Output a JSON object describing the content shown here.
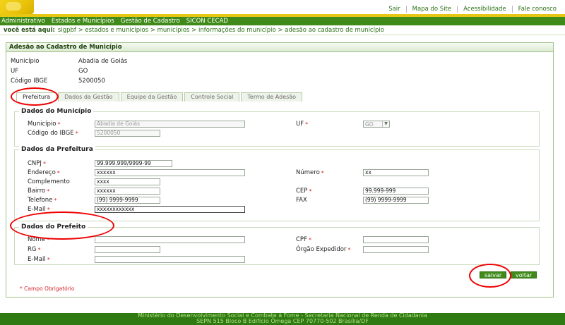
{
  "top_links": [
    "Sair",
    "Mapa do Site",
    "Acessibilidade",
    "Fale conosco"
  ],
  "main_nav": [
    "Administrativo",
    "Estados e Municípios",
    "Gestão de Cadastro",
    "SICON CECAD"
  ],
  "breadcrumb": {
    "here": "você está aqui:",
    "path": "sigpbf > estados e municípios > municípios > informações do município > adesão ao cadastro de município"
  },
  "panel": {
    "title": "Adesão ao Cadastro de Município",
    "info": [
      {
        "label": "Município",
        "value": "Abadia de Goiás"
      },
      {
        "label": "UF",
        "value": "GO"
      },
      {
        "label": "Código IBGE",
        "value": "5200050"
      }
    ]
  },
  "tabs": [
    "Prefeitura",
    "Dados da Gestão",
    "Equipe da Gestão",
    "Controle Social",
    "Termo de Adesão"
  ],
  "sections": {
    "municipio": {
      "title": "Dados do Município",
      "municipio_label": "Município",
      "municipio_value": "Abadia de Goiás",
      "ibge_label": "Código do IBGE",
      "ibge_value": "5200050",
      "uf_label": "UF",
      "uf_value": "GO"
    },
    "prefeitura": {
      "title": "Dados da Prefeitura",
      "cnpj_label": "CNPJ",
      "cnpj_value": "99.999.999/9999-99",
      "endereco_label": "Endereço",
      "endereco_value": "xxxxxx",
      "numero_label": "Número",
      "numero_value": "xx",
      "complemento_label": "Complemento",
      "complemento_value": "xxxx",
      "bairro_label": "Bairro",
      "bairro_value": "xxxxxx",
      "cep_label": "CEP",
      "cep_value": "99.999-999",
      "telefone_label": "Telefone",
      "telefone_value": "(99) 9999-9999",
      "fax_label": "FAX",
      "fax_value": "(99) 9999-9999",
      "email_label": "E-Mail",
      "email_value": "xxxxxxxxxxxx"
    },
    "prefeito": {
      "title": "Dados do Prefeito",
      "nome_label": "Nome",
      "cpf_label": "CPF",
      "rg_label": "RG",
      "orgao_label": "Órgão Expedidor",
      "email_label": "E-Mail"
    }
  },
  "required_marker": "*",
  "buttons": {
    "save": "salvar",
    "back": "voltar"
  },
  "legend": "* Campo Obrigatório",
  "footer": {
    "line1": "Ministério do Desenvolvimento Social e Combate à Fome - Secretaria Nacional de Renda de Cidadania",
    "line2": "SEPN 515 Bloco B Edifício Ômega CEP 70770-502 Brasília/DF"
  },
  "colors": {
    "nav_green": "#3f8a19",
    "accent_yellow": "#e6c713",
    "required_red": "#d6262a",
    "annotation_red": "#e00000"
  }
}
